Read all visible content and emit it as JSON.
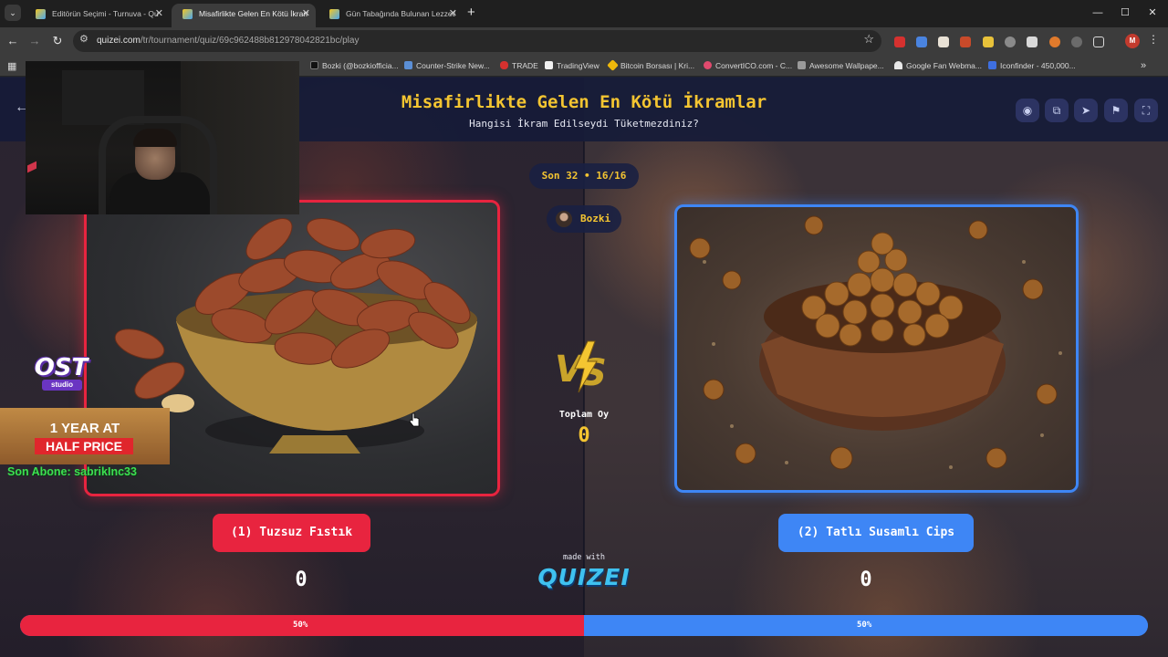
{
  "browser": {
    "tabs": [
      {
        "title": "Editörün Seçimi - Turnuva - Qu",
        "active": false
      },
      {
        "title": "Misafirlikte Gelen En Kötü İkram",
        "active": true
      },
      {
        "title": "Gün Tabağında Bulunan Lezzetl",
        "active": false
      }
    ],
    "url_host": "quizei.com",
    "url_path": "/tr/tournament/quiz/69c962488b812978042821bc/play",
    "profile_initial": "M",
    "bookmarks": [
      "Bozki (@bozkiofficia...",
      "Counter-Strike New...",
      "TRADE",
      "TradingView",
      "Bitcoin Borsası | Kri...",
      "ConvertICO.com - C...",
      "Awesome Wallpape...",
      "Google Fan Webma...",
      "Iconfinder - 450,000..."
    ]
  },
  "quiz": {
    "title": "Misafirlikte Gelen En Kötü İkramlar",
    "subtitle": "Hangisi İkram Edilseydi Tüketmezdiniz?",
    "round": "Son 32 • 16/16",
    "streamer": "Bozki",
    "total_votes_label": "Toplam Oy",
    "total_votes": "0",
    "made_with": "made with",
    "brand": "QUIZEI",
    "left": {
      "label": "(1) Tuzsuz Fıstık",
      "votes": "0",
      "percent": "50%",
      "share": 0.5
    },
    "right": {
      "label": "(2) Tatlı Susamlı Cips",
      "votes": "0",
      "percent": "50%",
      "share": 0.5
    }
  },
  "overlay": {
    "ost_logo": "OST",
    "ost_sub": "studio",
    "promo_line1": "1 YEAR AT",
    "promo_line2": "HALF PRICE",
    "last_subscriber": "Son Abone: sabrikInc33"
  },
  "colors": {
    "accent_yellow": "#f4c531",
    "left_red": "#e8243f",
    "right_blue": "#3e86f5",
    "header_navy": "#161b38"
  }
}
